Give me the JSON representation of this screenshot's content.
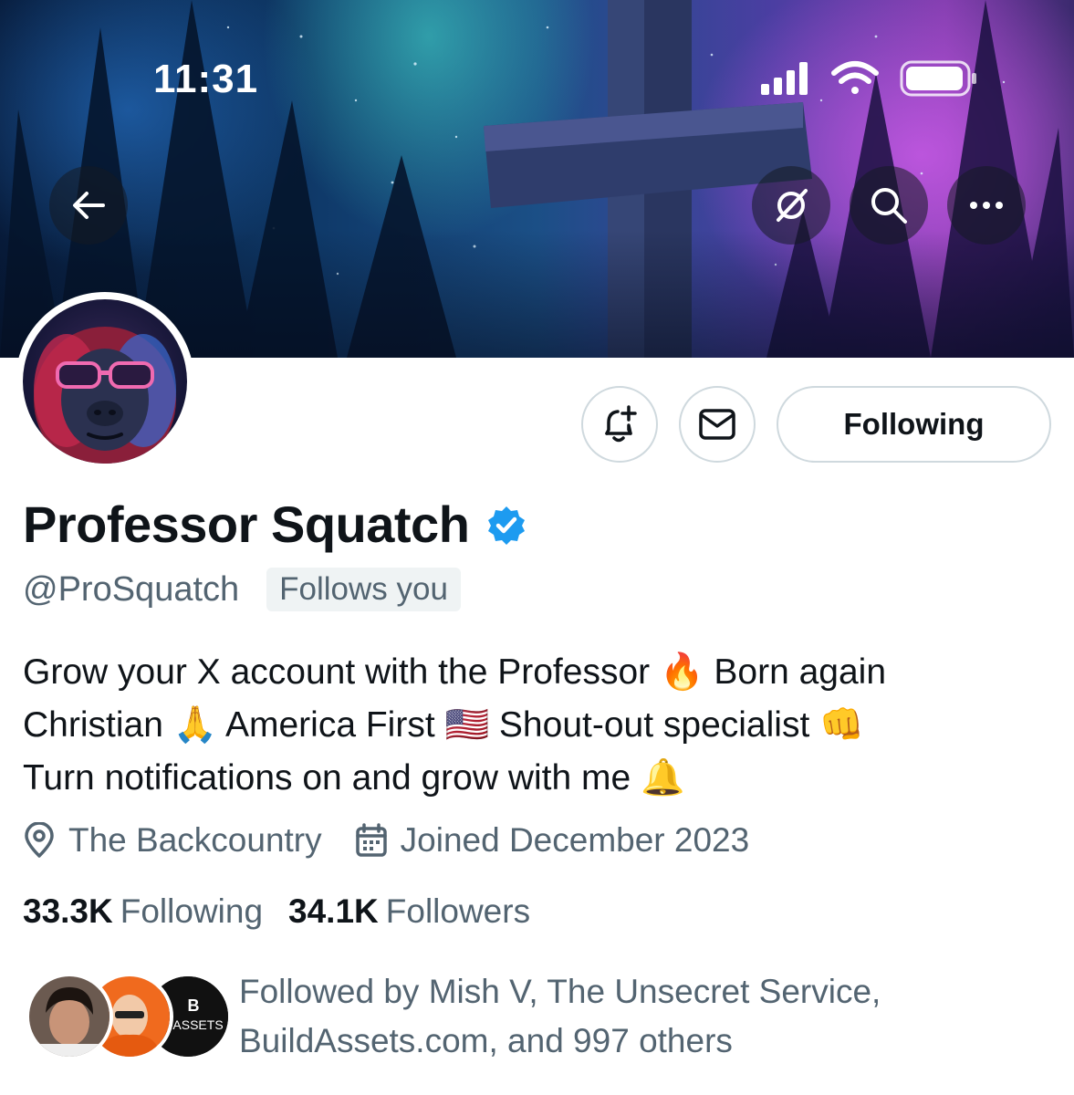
{
  "status_bar": {
    "time": "11:31",
    "icons": [
      "signal-icon",
      "wifi-icon",
      "battery-icon"
    ]
  },
  "header": {
    "back_icon": "back-arrow-icon",
    "actions": [
      "grok-icon",
      "search-icon",
      "more-icon"
    ]
  },
  "profile": {
    "display_name": "Professor Squatch",
    "verified": true,
    "handle": "@ProSquatch",
    "follows_you_label": "Follows you",
    "bio": {
      "line1_text": "Grow your X account with the Professor",
      "line1_emoji": "🔥",
      "line1_tail": "Born again",
      "line2_a": "Christian",
      "line2_emoji_a": "🙏",
      "line2_b": "America First",
      "line2_emoji_b": "🇺🇸",
      "line2_c": "Shout-out specialist",
      "line2_emoji_c": "👊",
      "line3_text": "Turn notifications on and grow with me",
      "line3_emoji": "🔔"
    },
    "location": "The Backcountry",
    "joined": "Joined December 2023",
    "following_count": "33.3K",
    "following_label": "Following",
    "followers_count": "34.1K",
    "followers_label": "Followers"
  },
  "actions": {
    "notify_icon": "bell-plus-icon",
    "message_icon": "envelope-icon",
    "following_button_label": "Following"
  },
  "followed_by": {
    "avatar_3_text": "DASSETS",
    "text": "Followed by Mish V, The Unsecret Service, BuildAssets.com, and 997 others"
  },
  "colors": {
    "verified_blue": "#1d9bf0",
    "secondary_text": "#536471",
    "primary_text": "#0f1419",
    "border": "#cfd9de"
  }
}
